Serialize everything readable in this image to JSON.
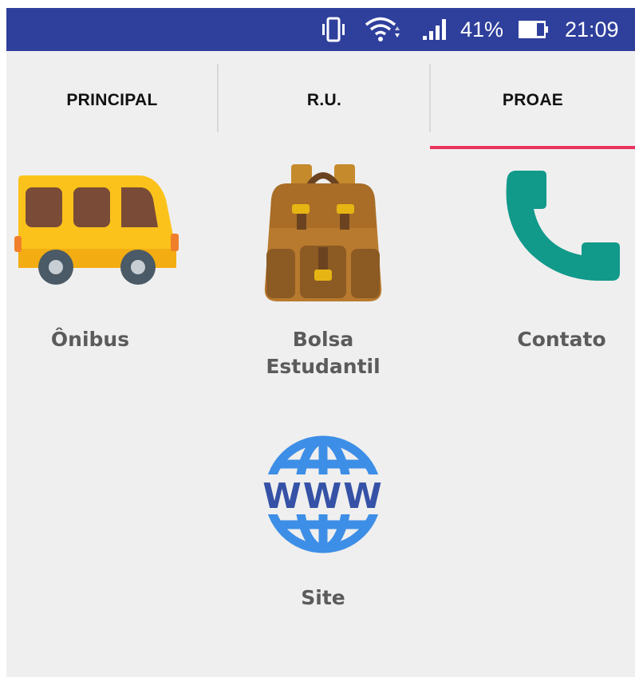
{
  "status_bar": {
    "battery_percent": "41%",
    "time": "21:09",
    "icons": [
      "vibrate-icon",
      "wifi-icon",
      "signal-icon",
      "battery-icon"
    ]
  },
  "tabs": [
    {
      "label": "PRINCIPAL",
      "selected": false
    },
    {
      "label": "R.U.",
      "selected": false
    },
    {
      "label": "PROAE",
      "selected": true
    }
  ],
  "colors": {
    "status_bar": "#2f3f9c",
    "tab_indicator": "#e8335c",
    "background": "#efefef",
    "label_text": "#5b5b5b"
  },
  "tiles": [
    {
      "icon": "bus-icon",
      "label": "Ônibus"
    },
    {
      "icon": "backpack-icon",
      "label_lines": [
        "Bolsa",
        "Estudantil"
      ]
    },
    {
      "icon": "phone-icon",
      "label": "Contato"
    },
    {
      "icon": "globe-www-icon",
      "label": "Site"
    }
  ]
}
